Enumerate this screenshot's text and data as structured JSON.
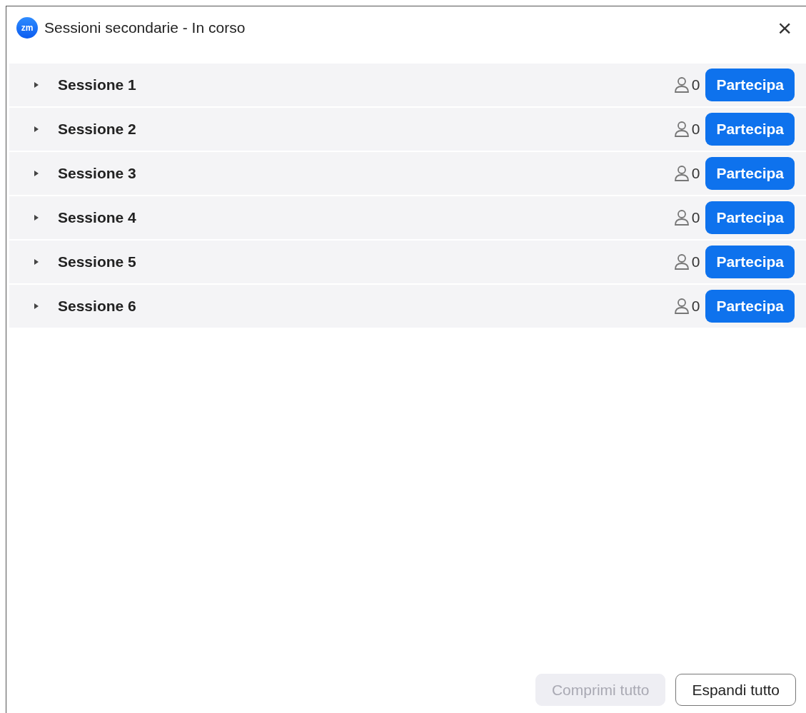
{
  "window": {
    "logo_text": "zm",
    "title": "Sessioni secondarie - In corso",
    "close": "×"
  },
  "sessions": [
    {
      "name": "Sessione 1",
      "expanded": false,
      "count": "0",
      "button": "Partecipa"
    },
    {
      "name": "Sessione 2",
      "expanded": false,
      "count": "0",
      "button": "Partecipa"
    },
    {
      "name": "Sessione 3",
      "expanded": false,
      "count": "0",
      "button": "Partecipa"
    },
    {
      "name": "Sessione 4",
      "expanded": false,
      "count": "0",
      "button": "Partecipa"
    },
    {
      "name": "Sessione 5",
      "expanded": false,
      "count": "0",
      "button": "Partecipa"
    },
    {
      "name": "Sessione 6",
      "expanded": false,
      "count": "0",
      "button": "Partecipa"
    }
  ],
  "footer_buttons": [
    {
      "label": "Comprimi tutto",
      "disabled": true
    },
    {
      "label": "Espandi tutto",
      "disabled": false
    }
  ]
}
